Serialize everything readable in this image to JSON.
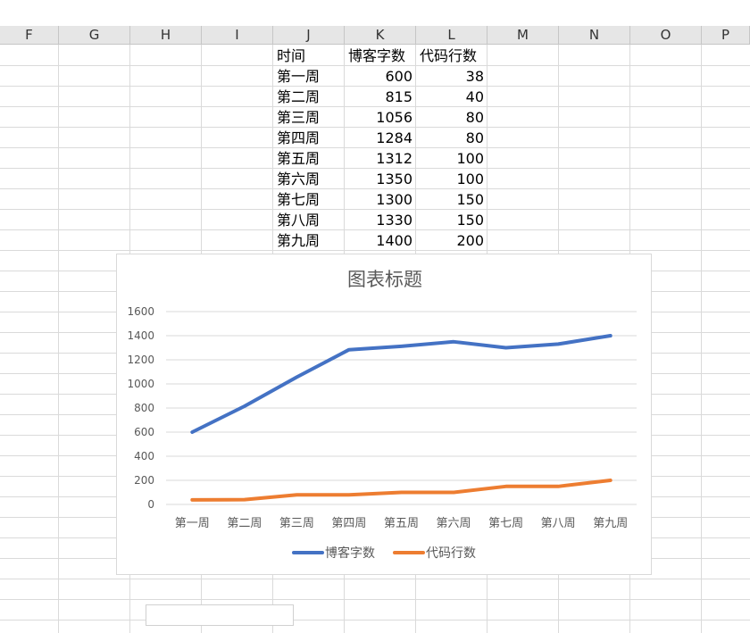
{
  "columns": [
    "F",
    "G",
    "H",
    "I",
    "J",
    "K",
    "L",
    "M",
    "N",
    "O",
    "P"
  ],
  "table": {
    "headers": [
      "时间",
      "博客字数",
      "代码行数"
    ],
    "rows": [
      [
        "第一周",
        "600",
        "38"
      ],
      [
        "第二周",
        "815",
        "40"
      ],
      [
        "第三周",
        "1056",
        "80"
      ],
      [
        "第四周",
        "1284",
        "80"
      ],
      [
        "第五周",
        "1312",
        "100"
      ],
      [
        "第六周",
        "1350",
        "100"
      ],
      [
        "第七周",
        "1300",
        "150"
      ],
      [
        "第八周",
        "1330",
        "150"
      ],
      [
        "第九周",
        "1400",
        "200"
      ]
    ]
  },
  "chart_data": {
    "type": "line",
    "title": "图表标题",
    "categories": [
      "第一周",
      "第二周",
      "第三周",
      "第四周",
      "第五周",
      "第六周",
      "第七周",
      "第八周",
      "第九周"
    ],
    "series": [
      {
        "name": "博客字数",
        "color": "#4472c4",
        "values": [
          600,
          815,
          1056,
          1284,
          1312,
          1350,
          1300,
          1330,
          1400
        ]
      },
      {
        "name": "代码行数",
        "color": "#ed7d31",
        "values": [
          38,
          40,
          80,
          80,
          100,
          100,
          150,
          150,
          200
        ]
      }
    ],
    "yticks": [
      0,
      200,
      400,
      600,
      800,
      1000,
      1200,
      1400,
      1600
    ],
    "ylim": [
      0,
      1600
    ],
    "grid": true,
    "legend_position": "bottom",
    "xlabel": "",
    "ylabel": ""
  }
}
